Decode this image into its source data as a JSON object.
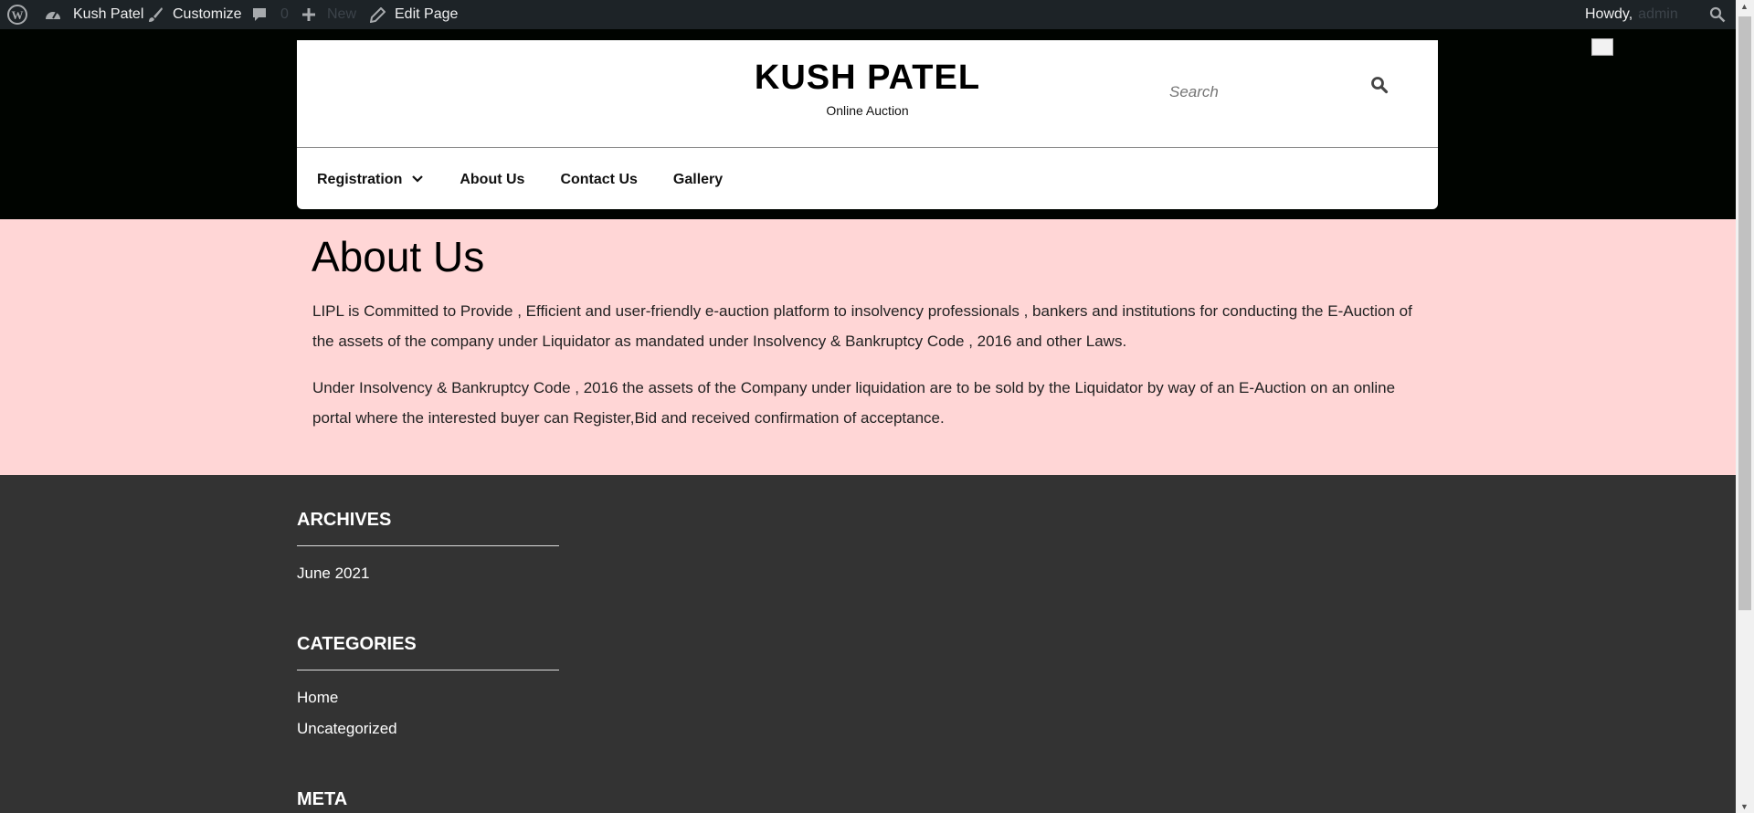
{
  "admin_bar": {
    "site_name": "Kush Patel",
    "customize": "Customize",
    "comments_count": "0",
    "new": "New",
    "edit_page": "Edit Page",
    "howdy": "Howdy,",
    "username": "admin"
  },
  "header": {
    "site_title": "KUSH PATEL",
    "tagline": "Online Auction",
    "search_placeholder": "Search"
  },
  "nav": {
    "items": [
      {
        "label": "Registration",
        "has_submenu": true
      },
      {
        "label": "About Us"
      },
      {
        "label": "Contact Us"
      },
      {
        "label": "Gallery"
      }
    ]
  },
  "content": {
    "heading": "About Us",
    "paragraphs": [
      "LIPL is Committed to Provide , Efficient and user-friendly e-auction platform to insolvency professionals , bankers and institutions for conducting the E-Auction of the assets of the company under Liquidator as mandated under Insolvency & Bankruptcy Code , 2016 and other Laws.",
      "Under Insolvency & Bankruptcy Code , 2016 the assets of the Company under liquidation are to be sold by the Liquidator by way of an E-Auction on an online portal where the interested buyer can Register,Bid and received confirmation of acceptance."
    ]
  },
  "footer": {
    "archives": {
      "title": "ARCHIVES",
      "items": [
        "June 2021"
      ]
    },
    "categories": {
      "title": "CATEGORIES",
      "items": [
        "Home",
        "Uncategorized"
      ]
    },
    "meta": {
      "title": "META"
    }
  },
  "colors": {
    "admin_bar_bg": "#1d2327",
    "page_bg": "#000400",
    "content_bg": "#ffd6d6",
    "footer_bg": "#333333"
  },
  "icons": {
    "wp_logo": "wordpress-logo-icon",
    "dashboard": "dashboard-icon",
    "customize": "paintbrush-icon",
    "comments": "comment-bubble-icon",
    "new": "plus-icon",
    "edit": "pencil-icon",
    "admin_search": "search-icon",
    "header_search": "search-icon",
    "submenu": "chevron-down-icon"
  }
}
